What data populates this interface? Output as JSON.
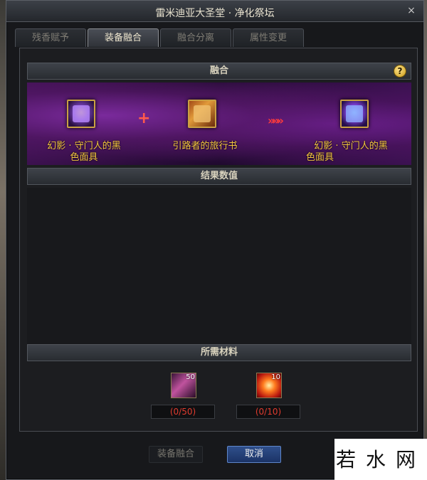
{
  "window": {
    "title": "雷米迪亚大圣堂 · 净化祭坛",
    "close_symbol": "×"
  },
  "tabs": [
    {
      "label": "残香赋予"
    },
    {
      "label": "装备融合",
      "active": true
    },
    {
      "label": "融合分离"
    },
    {
      "label": "属性变更"
    }
  ],
  "fusion": {
    "header": "融合",
    "help_symbol": "?",
    "left_item": {
      "name_line1": "幻影 · 守门人的黑",
      "name_line2": "色面具",
      "icon": "mask-icon"
    },
    "middle_item": {
      "name": "引路者的旅行书",
      "icon": "book-icon"
    },
    "result_item": {
      "name_line1": "幻影 · 守门人的黑",
      "name_line2": "色面具",
      "icon": "mask-icon"
    },
    "plus_symbol": "+",
    "arrow_symbol": "»»»"
  },
  "result": {
    "header": "结果数值"
  },
  "materials": {
    "header": "所需材料",
    "items": [
      {
        "icon": "crystal-icon",
        "required": "50",
        "progress": "(0/50)"
      },
      {
        "icon": "sun-stone-icon",
        "required": "10",
        "progress": "(0/10)"
      }
    ]
  },
  "buttons": {
    "fuse_label": "装备融合",
    "cancel_label": "取消"
  },
  "watermark": {
    "text": "若水网"
  }
}
